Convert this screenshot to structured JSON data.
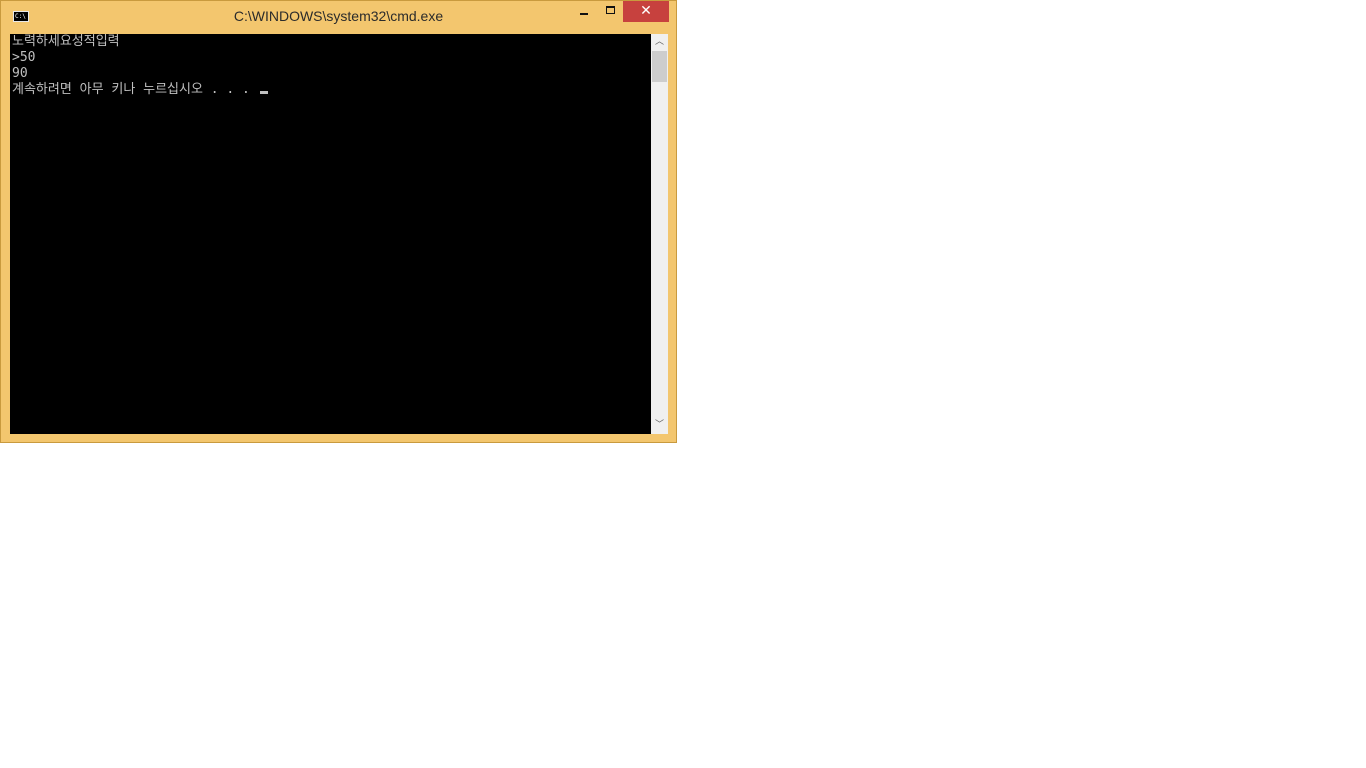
{
  "window": {
    "title": "C:\\WINDOWS\\system32\\cmd.exe",
    "icon": "cmd-icon",
    "icon_text": "C:\\",
    "controls": {
      "minimize": "minimize-icon",
      "maximize": "maximize-icon",
      "close": "close-icon",
      "close_glyph": "✕"
    },
    "frame_color": "#f3c66e",
    "close_color": "#c7413e"
  },
  "console": {
    "background": "#000000",
    "foreground": "#c0c0c0",
    "lines": [
      "노력하세요성적입력",
      ">50",
      "90",
      "계속하려면 아무 키나 누르십시오 . . . "
    ]
  },
  "scrollbar": {
    "up_glyph": "︿",
    "down_glyph": "﹀"
  }
}
